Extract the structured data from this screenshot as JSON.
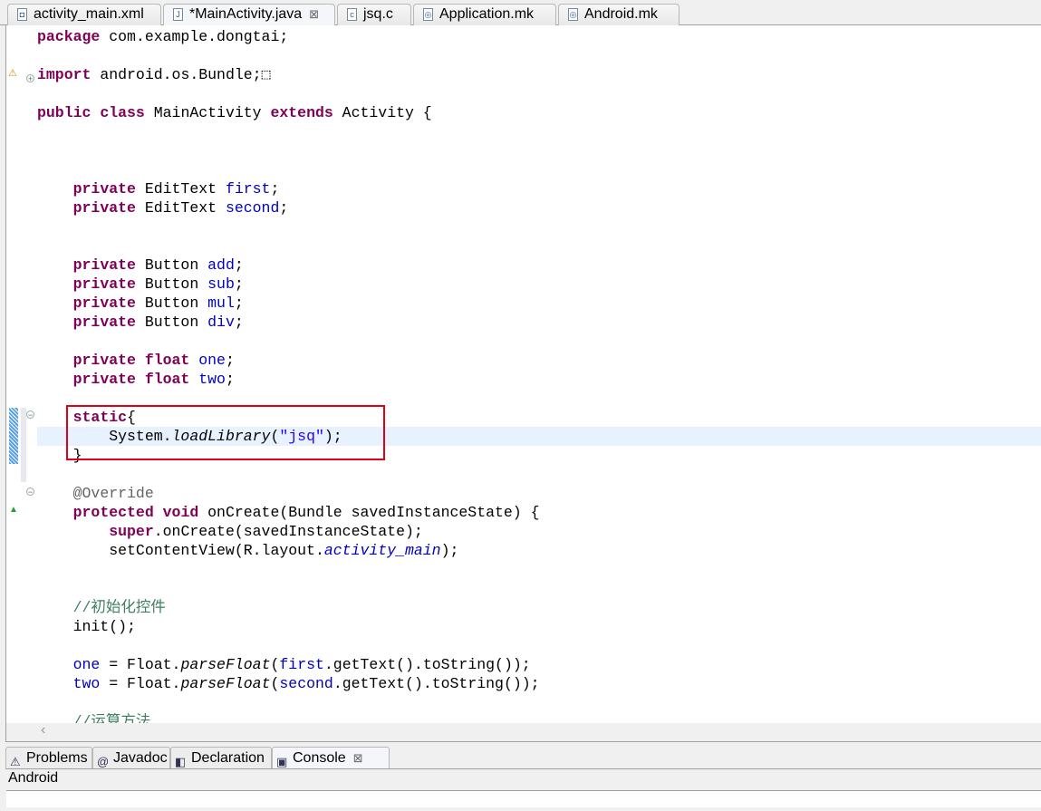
{
  "editor_tabs": [
    {
      "label": "activity_main.xml",
      "icon": "xml-file-icon",
      "glyph": "◘",
      "active": false
    },
    {
      "label": "*MainActivity.java",
      "icon": "java-file-icon",
      "glyph": "J",
      "active": true,
      "closable": true
    },
    {
      "label": "jsq.c",
      "icon": "c-file-icon",
      "glyph": "c",
      "active": false
    },
    {
      "label": "Application.mk",
      "icon": "makefile-icon",
      "glyph": "◎",
      "active": false
    },
    {
      "label": "Android.mk",
      "icon": "makefile-icon",
      "glyph": "◎",
      "active": false
    }
  ],
  "code_lines": [
    [
      [
        "kw",
        "package"
      ],
      [
        "",
        " com.example.dongtai;"
      ]
    ],
    [],
    [
      [
        "kw",
        "import"
      ],
      [
        "",
        " android.os.Bundle;"
      ],
      [
        "",
        "⬚"
      ]
    ],
    [],
    [
      [
        "kw",
        "public"
      ],
      [
        "",
        " "
      ],
      [
        "kw",
        "class"
      ],
      [
        "",
        " MainActivity "
      ],
      [
        "kw",
        "extends"
      ],
      [
        "",
        " Activity {"
      ]
    ],
    [],
    [],
    [],
    [
      [
        "",
        "    "
      ],
      [
        "kw",
        "private"
      ],
      [
        "",
        " EditText "
      ],
      [
        "fd",
        "first"
      ],
      [
        "",
        ";"
      ]
    ],
    [
      [
        "",
        "    "
      ],
      [
        "kw",
        "private"
      ],
      [
        "",
        " EditText "
      ],
      [
        "fd",
        "second"
      ],
      [
        "",
        ";"
      ]
    ],
    [],
    [],
    [
      [
        "",
        "    "
      ],
      [
        "kw",
        "private"
      ],
      [
        "",
        " Button "
      ],
      [
        "fd",
        "add"
      ],
      [
        "",
        ";"
      ]
    ],
    [
      [
        "",
        "    "
      ],
      [
        "kw",
        "private"
      ],
      [
        "",
        " Button "
      ],
      [
        "fd",
        "sub"
      ],
      [
        "",
        ";"
      ]
    ],
    [
      [
        "",
        "    "
      ],
      [
        "kw",
        "private"
      ],
      [
        "",
        " Button "
      ],
      [
        "fd",
        "mul"
      ],
      [
        "",
        ";"
      ]
    ],
    [
      [
        "",
        "    "
      ],
      [
        "kw",
        "private"
      ],
      [
        "",
        " Button "
      ],
      [
        "fd",
        "div"
      ],
      [
        "",
        ";"
      ]
    ],
    [],
    [
      [
        "",
        "    "
      ],
      [
        "kw",
        "private"
      ],
      [
        "",
        " "
      ],
      [
        "kw",
        "float"
      ],
      [
        "",
        " "
      ],
      [
        "fd",
        "one"
      ],
      [
        "",
        ";"
      ]
    ],
    [
      [
        "",
        "    "
      ],
      [
        "kw",
        "private"
      ],
      [
        "",
        " "
      ],
      [
        "kw",
        "float"
      ],
      [
        "",
        " "
      ],
      [
        "fd",
        "two"
      ],
      [
        "",
        ";"
      ]
    ],
    [],
    [
      [
        "",
        "    "
      ],
      [
        "kw",
        "static"
      ],
      [
        "",
        "{"
      ]
    ],
    [
      [
        "",
        "        System."
      ],
      [
        "it",
        "loadLibrary"
      ],
      [
        "",
        "("
      ],
      [
        "st",
        "\"jsq\""
      ],
      [
        "",
        ");"
      ]
    ],
    [
      [
        "",
        "    }"
      ]
    ],
    [],
    [
      [
        "",
        "    "
      ],
      [
        "an",
        "@Override"
      ]
    ],
    [
      [
        "",
        "    "
      ],
      [
        "kw",
        "protected"
      ],
      [
        "",
        " "
      ],
      [
        "kw",
        "void"
      ],
      [
        "",
        " onCreate(Bundle savedInstanceState) {"
      ]
    ],
    [
      [
        "",
        "        "
      ],
      [
        "kw",
        "super"
      ],
      [
        "",
        ".onCreate(savedInstanceState);"
      ]
    ],
    [
      [
        "",
        "        setContentView(R.layout."
      ],
      [
        "itf",
        "activity_main"
      ],
      [
        "",
        ");"
      ]
    ],
    [],
    [],
    [
      [
        "",
        "    "
      ],
      [
        "cm",
        "//初始化控件"
      ]
    ],
    [
      [
        "",
        "    init();"
      ]
    ],
    [],
    [
      [
        "",
        "    "
      ],
      [
        "fd",
        "one"
      ],
      [
        "",
        " = Float."
      ],
      [
        "it",
        "parseFloat"
      ],
      [
        "",
        "("
      ],
      [
        "fd",
        "first"
      ],
      [
        "",
        ".getText().toString());"
      ]
    ],
    [
      [
        "",
        "    "
      ],
      [
        "fd",
        "two"
      ],
      [
        "",
        " = Float."
      ],
      [
        "it",
        "parseFloat"
      ],
      [
        "",
        "("
      ],
      [
        "fd",
        "second"
      ],
      [
        "",
        ".getText().toString());"
      ]
    ],
    [],
    [
      [
        "",
        "    "
      ],
      [
        "cm",
        "//运算方法"
      ]
    ]
  ],
  "current_line": 21,
  "highlight_color": "#E0001A",
  "panel_tabs": [
    {
      "label": "Problems",
      "icon": "problems-icon",
      "glyph": "⚠"
    },
    {
      "label": "Javadoc",
      "icon": "javadoc-icon",
      "glyph": "@"
    },
    {
      "label": "Declaration",
      "icon": "declaration-icon",
      "glyph": "◧"
    },
    {
      "label": "Console",
      "icon": "console-icon",
      "glyph": "▣",
      "active": true,
      "closable": true
    }
  ],
  "console": {
    "title": "Android"
  }
}
